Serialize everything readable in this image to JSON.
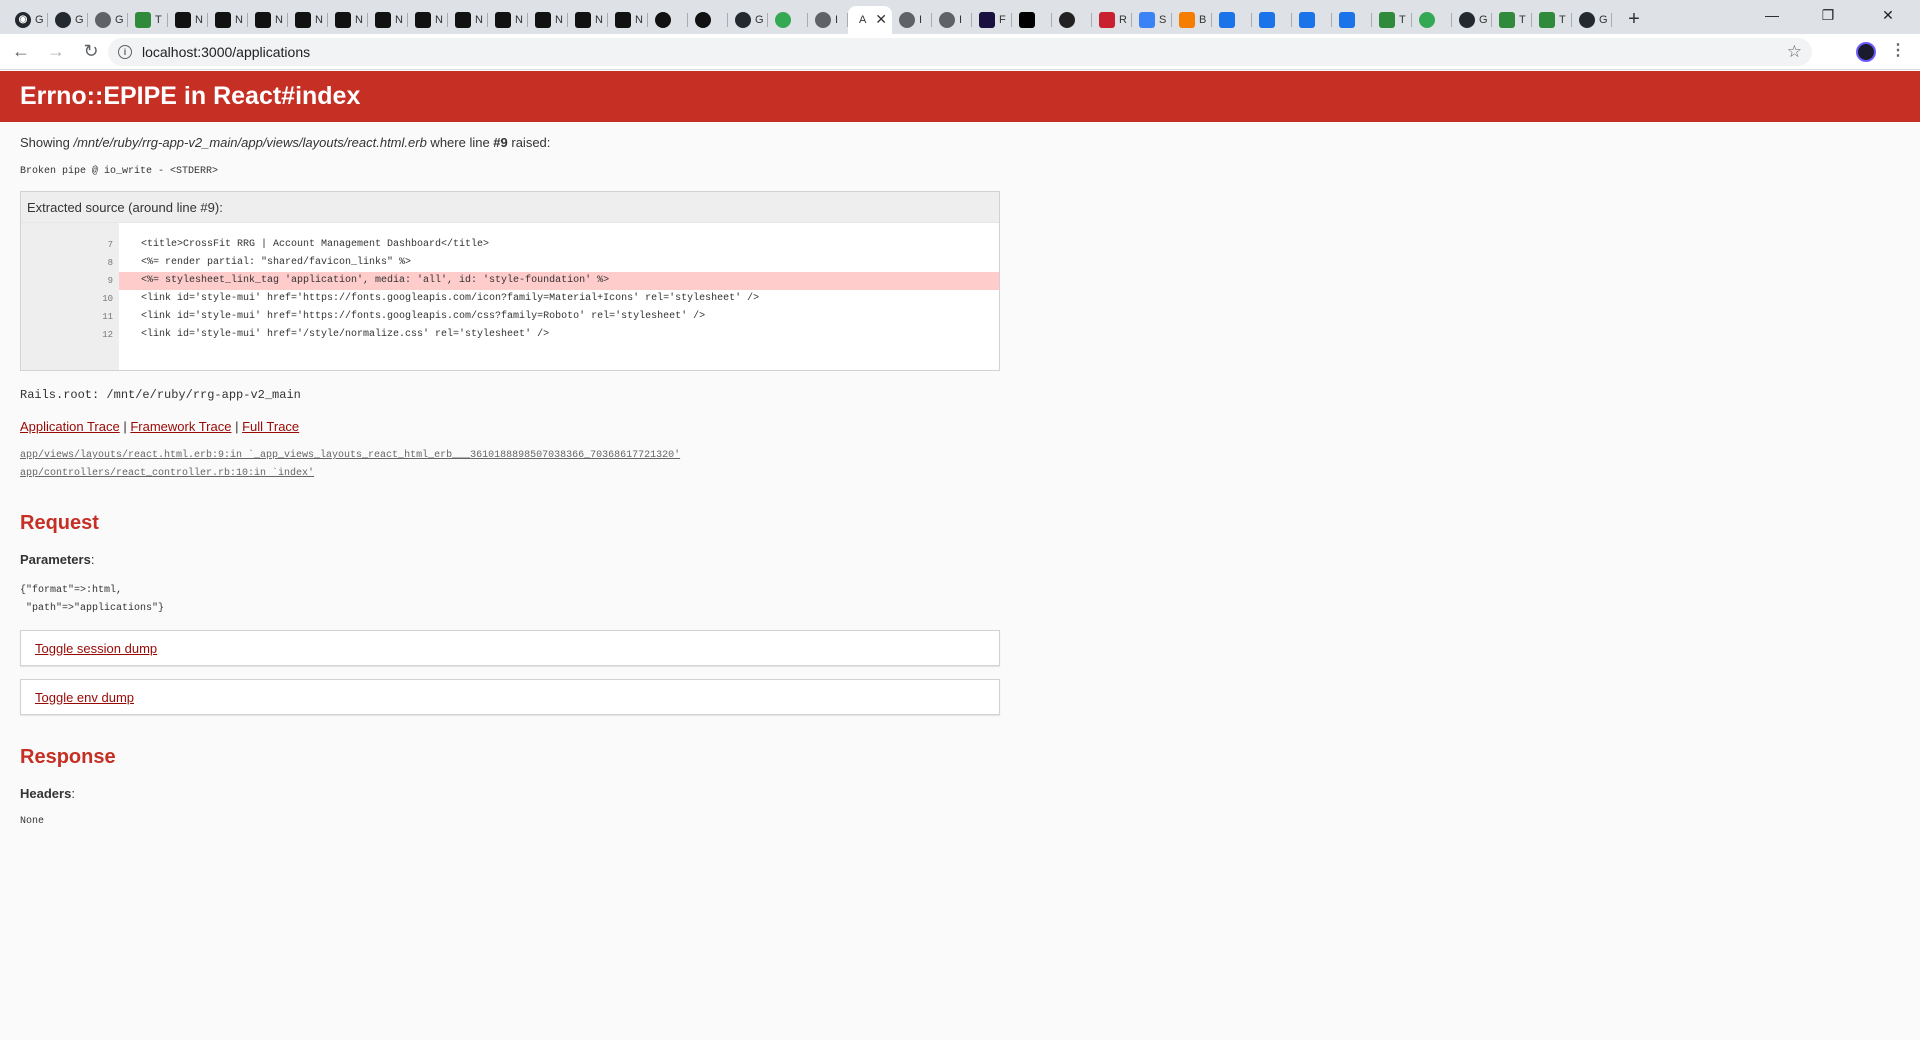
{
  "browser": {
    "tabs": [
      {
        "icon": "github-icon",
        "label": "G",
        "color": "#24292f",
        "round": true
      },
      {
        "icon": "github-icon",
        "label": "G",
        "color": "#24292f",
        "round": true
      },
      {
        "icon": "globe-icon",
        "label": "G",
        "color": "#5f6368",
        "round": true
      },
      {
        "icon": "trello-icon",
        "label": "T",
        "color": "#2f8a3b",
        "round": false
      },
      {
        "icon": "notion-icon",
        "label": "N",
        "color": "#111111",
        "round": false
      },
      {
        "icon": "notion-icon",
        "label": "N",
        "color": "#111111",
        "round": false
      },
      {
        "icon": "notion-icon",
        "label": "N",
        "color": "#111111",
        "round": false
      },
      {
        "icon": "notion-icon",
        "label": "N",
        "color": "#111111",
        "round": false
      },
      {
        "icon": "notion-icon",
        "label": "N",
        "color": "#111111",
        "round": false
      },
      {
        "icon": "notion-icon",
        "label": "N",
        "color": "#111111",
        "round": false
      },
      {
        "icon": "notion-icon",
        "label": "N",
        "color": "#111111",
        "round": false
      },
      {
        "icon": "notion-icon",
        "label": "N",
        "color": "#111111",
        "round": false
      },
      {
        "icon": "notion-icon",
        "label": "N",
        "color": "#111111",
        "round": false
      },
      {
        "icon": "notion-icon",
        "label": "N",
        "color": "#111111",
        "round": false
      },
      {
        "icon": "notion-icon",
        "label": "N",
        "color": "#111111",
        "round": false
      },
      {
        "icon": "notion-icon",
        "label": "N",
        "color": "#111111",
        "round": false
      },
      {
        "icon": "hashnode-icon",
        "label": "",
        "color": "#111111",
        "round": true
      },
      {
        "icon": "hashnode-icon",
        "label": "",
        "color": "#111111",
        "round": true
      },
      {
        "icon": "github-icon",
        "label": "G",
        "color": "#24292f",
        "round": true
      },
      {
        "icon": "chrome-icon",
        "label": "",
        "color": "#34a853",
        "round": true
      },
      {
        "icon": "globe-icon",
        "label": "I",
        "color": "#5f6368",
        "round": true
      },
      {
        "icon": "globe-icon",
        "label": "I",
        "color": "#5f6368",
        "round": true
      },
      {
        "icon": "globe-icon",
        "label": "I",
        "color": "#5f6368",
        "round": true
      },
      {
        "icon": "font-icon",
        "label": "F",
        "color": "#1b1040",
        "round": false
      },
      {
        "icon": "medium-icon",
        "label": "",
        "color": "#000000",
        "round": false
      },
      {
        "icon": "circle-icon",
        "label": "",
        "color": "#222222",
        "round": true
      },
      {
        "icon": "app-icon",
        "label": "R",
        "color": "#c8202f",
        "round": false
      },
      {
        "icon": "star-icon",
        "label": "S",
        "color": "#3b82f6",
        "round": false
      },
      {
        "icon": "blogger-icon",
        "label": "B",
        "color": "#f57d00",
        "round": false
      },
      {
        "icon": "diamond-icon",
        "label": "",
        "color": "#1a73e8",
        "round": false
      },
      {
        "icon": "diamond-icon",
        "label": "",
        "color": "#1a73e8",
        "round": false
      },
      {
        "icon": "diamond-icon",
        "label": "",
        "color": "#1a73e8",
        "round": false
      },
      {
        "icon": "diamond-icon",
        "label": "",
        "color": "#1a73e8",
        "round": false
      },
      {
        "icon": "trello-icon",
        "label": "T",
        "color": "#2f8a3b",
        "round": false
      },
      {
        "icon": "chrome-icon",
        "label": "",
        "color": "#34a853",
        "round": true
      },
      {
        "icon": "github-icon",
        "label": "G",
        "color": "#24292f",
        "round": true
      },
      {
        "icon": "trello-icon",
        "label": "T",
        "color": "#2f8a3b",
        "round": false
      },
      {
        "icon": "trello-icon",
        "label": "T",
        "color": "#2f8a3b",
        "round": false
      },
      {
        "icon": "github-icon",
        "label": "G",
        "color": "#24292f",
        "round": true
      }
    ],
    "active_tab_label": "A",
    "url": "localhost:3000/applications"
  },
  "error": {
    "title": "Errno::EPIPE in React#index",
    "showing_prefix": "Showing ",
    "file_path": "/mnt/e/ruby/rrg-app-v2_main/app/views/layouts/react.html.erb",
    "showing_middle": " where line ",
    "line_ref": "#9",
    "showing_suffix": " raised:",
    "message": "Broken pipe @ io_write - <STDERR>"
  },
  "source": {
    "title": "Extracted source (around line #9):",
    "lines": [
      {
        "num": "7",
        "code": "<title>CrossFit RRG | Account Management Dashboard</title>",
        "highlight": false
      },
      {
        "num": "8",
        "code": "<%= render partial: \"shared/favicon_links\" %>",
        "highlight": false
      },
      {
        "num": "9",
        "code": "<%= stylesheet_link_tag 'application', media: 'all', id: 'style-foundation' %>",
        "highlight": true
      },
      {
        "num": "10",
        "code": "<link id='style-mui' href='https://fonts.googleapis.com/icon?family=Material+Icons' rel='stylesheet' />",
        "highlight": false
      },
      {
        "num": "11",
        "code": "<link id='style-mui' href='https://fonts.googleapis.com/css?family=Roboto' rel='stylesheet' />",
        "highlight": false
      },
      {
        "num": "12",
        "code": "<link id='style-mui' href='/style/normalize.css' rel='stylesheet' />",
        "highlight": false
      }
    ]
  },
  "rails_root": "Rails.root: /mnt/e/ruby/rrg-app-v2_main",
  "traces": {
    "application": "Application Trace",
    "framework": "Framework Trace",
    "full": "Full Trace",
    "separator": " | ",
    "lines": [
      "app/views/layouts/react.html.erb:9:in `_app_views_layouts_react_html_erb___3610188898507038366_70368617721320'",
      "app/controllers/react_controller.rb:10:in `index'"
    ]
  },
  "request": {
    "heading": "Request",
    "params_label": "Parameters",
    "params_colon": ":",
    "params_value": "{\"format\"=>:html,\n \"path\"=>\"applications\"}",
    "toggle_session": "Toggle session dump",
    "toggle_env": "Toggle env dump"
  },
  "response": {
    "heading": "Response",
    "headers_label": "Headers",
    "headers_colon": ":",
    "headers_value": "None"
  }
}
